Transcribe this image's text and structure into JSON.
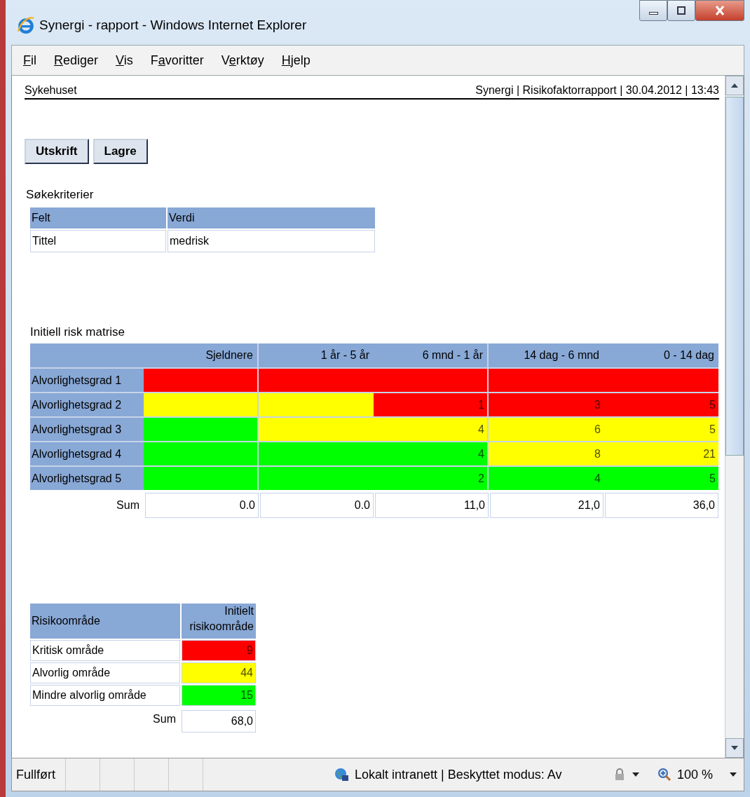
{
  "window": {
    "title": "Synergi - rapport - Windows Internet Explorer"
  },
  "menu": [
    {
      "key": "F",
      "after": "il"
    },
    {
      "key": "R",
      "after": "ediger"
    },
    {
      "key": "V",
      "after": "is"
    },
    {
      "before": "F",
      "key": "a",
      "after": "voritter"
    },
    {
      "before": "V",
      "key": "e",
      "after": "rktøy"
    },
    {
      "key": "H",
      "after": "jelp"
    }
  ],
  "page_header": {
    "left": "Sykehuset",
    "right": "Synergi | Risikofaktorrapport | 30.04.2012 | 13:43"
  },
  "buttons": [
    "Utskrift",
    "Lagre"
  ],
  "criteria": {
    "title": "Søkekriterier",
    "columns": [
      "Felt",
      "Verdi"
    ],
    "rows": [
      [
        "Tittel",
        "medrisk"
      ]
    ]
  },
  "matrix": {
    "title": "Initiell risk matrise",
    "columns": [
      {
        "label": "Sjeldnere",
        "divider_after": true
      },
      {
        "label": "1 år - 5 år",
        "divider_after": false
      },
      {
        "label": "6 mnd - 1 år",
        "divider_after": true
      },
      {
        "label": "14 dag - 6 mnd",
        "divider_after": false
      },
      {
        "label": "0 - 14 dag",
        "divider_after": false
      }
    ],
    "rows": [
      {
        "label": "Alvorlighetsgrad 1",
        "cells": [
          {
            "color": "#ff0000"
          },
          {
            "color": "#ff0000"
          },
          {
            "color": "#ff0000"
          },
          {
            "color": "#ff0000"
          },
          {
            "color": "#ff0000"
          }
        ]
      },
      {
        "label": "Alvorlighetsgrad 2",
        "cells": [
          {
            "color": "#ffff00"
          },
          {
            "color": "#ffff00"
          },
          {
            "color": "#ff0000",
            "value": "1"
          },
          {
            "color": "#ff0000",
            "value": "3"
          },
          {
            "color": "#ff0000",
            "value": "5"
          }
        ]
      },
      {
        "label": "Alvorlighetsgrad 3",
        "cells": [
          {
            "color": "#00ff00"
          },
          {
            "color": "#ffff00"
          },
          {
            "color": "#ffff00",
            "value": "4"
          },
          {
            "color": "#ffff00",
            "value": "6"
          },
          {
            "color": "#ffff00",
            "value": "5"
          }
        ]
      },
      {
        "label": "Alvorlighetsgrad 4",
        "cells": [
          {
            "color": "#00ff00"
          },
          {
            "color": "#00ff00"
          },
          {
            "color": "#00ff00",
            "value": "4"
          },
          {
            "color": "#ffff00",
            "value": "8"
          },
          {
            "color": "#ffff00",
            "value": "21"
          }
        ]
      },
      {
        "label": "Alvorlighetsgrad 5",
        "cells": [
          {
            "color": "#00ff00"
          },
          {
            "color": "#00ff00"
          },
          {
            "color": "#00ff00",
            "value": "2"
          },
          {
            "color": "#00ff00",
            "value": "4"
          },
          {
            "color": "#00ff00",
            "value": "5"
          }
        ]
      }
    ],
    "sum_label": "Sum",
    "sums": [
      "0.0",
      "0.0",
      "11,0",
      "21,0",
      "36,0"
    ]
  },
  "areas": {
    "columns": [
      "Risikoområde",
      "Initielt risikoområde"
    ],
    "rows": [
      {
        "label": "Kritisk område",
        "value": "9",
        "color": "#ff0000"
      },
      {
        "label": "Alvorlig område",
        "value": "44",
        "color": "#ffff00"
      },
      {
        "label": "Mindre alvorlig område",
        "value": "15",
        "color": "#00ff00"
      }
    ],
    "sum_label": "Sum",
    "sum": "68,0"
  },
  "status_bar": {
    "status": "Fullført",
    "zone": "Lokalt intranett | Beskyttet modus: Av",
    "zoom": "100 %"
  }
}
